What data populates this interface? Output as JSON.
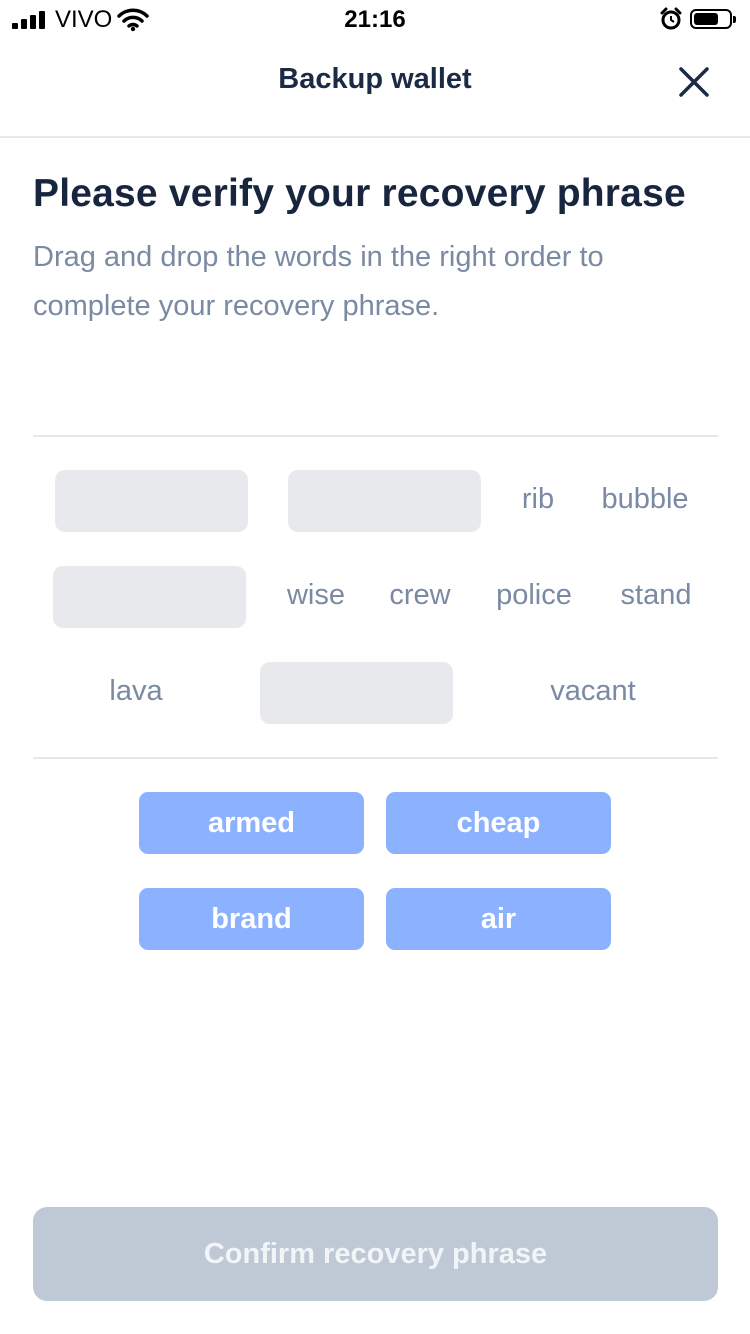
{
  "status_bar": {
    "carrier": "VIVO",
    "time": "21:16",
    "battery_level": 0.7
  },
  "header": {
    "title": "Backup wallet",
    "close_icon": "close-icon"
  },
  "main": {
    "title": "Please verify your recovery phrase",
    "subtitle": "Drag and drop the words in the right order to complete your recovery phrase.",
    "placed_words": {
      "rib": "rib",
      "bubble": "bubble",
      "wise": "wise",
      "crew": "crew",
      "police": "police",
      "stand": "stand",
      "lava": "lava",
      "vacant": "vacant"
    },
    "word_bank": [
      "armed",
      "cheap",
      "brand",
      "air"
    ]
  },
  "confirm_button": {
    "label": "Confirm recovery phrase"
  },
  "colors": {
    "accent_chip": "#8bb1ff",
    "title": "#17253f",
    "muted": "#7b8aa3",
    "disabled_button": "#bfc9d5"
  }
}
